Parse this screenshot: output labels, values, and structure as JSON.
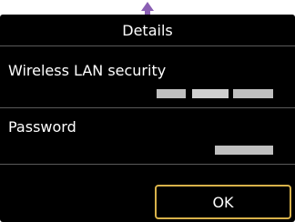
{
  "screen": {
    "title": "Details",
    "fields": [
      {
        "label": "Wireless LAN security"
      },
      {
        "label": "Password"
      }
    ],
    "ok_label": "OK"
  },
  "colors": {
    "background": "#000000",
    "text": "#ffffff",
    "button_border": "#d8b24a",
    "scroll_arrow": "#8a5fb3",
    "masked_value": "#bfbfbf"
  },
  "icons": {
    "scroll_indicator": "scroll-up-arrow-icon"
  }
}
